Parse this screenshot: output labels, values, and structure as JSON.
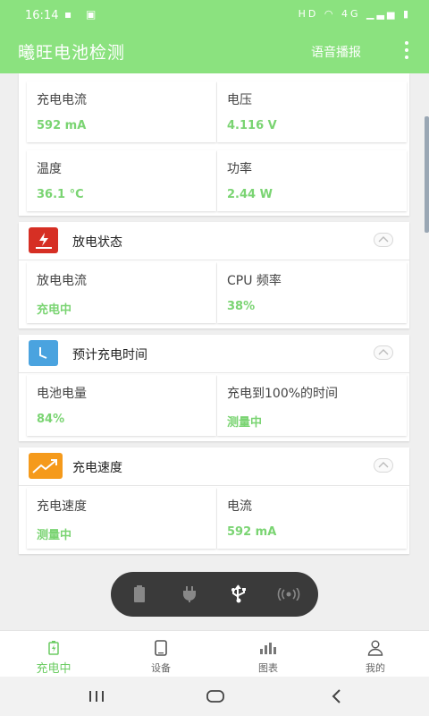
{
  "status_bar": {
    "time": "16:14",
    "network": "HD",
    "signal": "4G"
  },
  "app": {
    "title": "曦旺电池检测",
    "voice_label": "语音播报"
  },
  "top_section": {
    "cells": [
      {
        "label": "充电电流",
        "value": "592 mA"
      },
      {
        "label": "电压",
        "value": "4.116 V"
      },
      {
        "label": "温度",
        "value": "36.1 °C"
      },
      {
        "label": "功率",
        "value": "2.44 W"
      }
    ]
  },
  "discharge_section": {
    "title": "放电状态",
    "icon_color": "#d62f24",
    "cells": [
      {
        "label": "放电电流",
        "value": "充电中"
      },
      {
        "label": "CPU 频率",
        "value": "38%"
      }
    ]
  },
  "estimate_section": {
    "title": "预计充电时间",
    "icon_color": "#4aa3df",
    "cells": [
      {
        "label": "电池电量",
        "value": "84%"
      },
      {
        "label": "充电到100%的时间",
        "value": "测量中"
      }
    ]
  },
  "speed_section": {
    "title": "充电速度",
    "icon_color": "#f59a1b",
    "cells": [
      {
        "label": "充电速度",
        "value": "测量中"
      },
      {
        "label": "电流",
        "value": "592 mA"
      }
    ]
  },
  "floating_bar": {
    "items": [
      "battery-icon",
      "plug-icon",
      "usb-icon",
      "wireless-icon"
    ],
    "active": "usb-icon"
  },
  "bottom_nav": {
    "items": [
      {
        "label": "充电中",
        "icon": "battery-charging-icon",
        "active": true
      },
      {
        "label": "设备",
        "icon": "phone-icon",
        "active": false
      },
      {
        "label": "图表",
        "icon": "bar-chart-icon",
        "active": false
      },
      {
        "label": "我的",
        "icon": "person-icon",
        "active": false
      }
    ]
  },
  "colors": {
    "accent": "#8be27f",
    "value_green": "#7ad472"
  }
}
